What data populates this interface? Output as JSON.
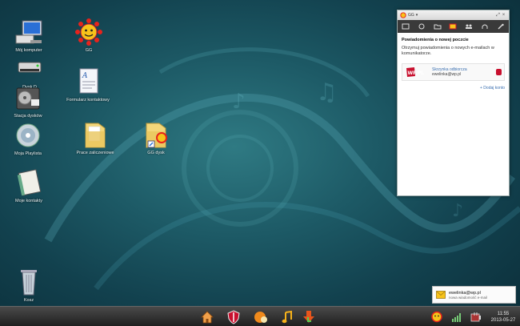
{
  "desktop_icons": [
    {
      "id": "moj-komputer",
      "label": "Mój komputer",
      "icon": "computer-icon"
    },
    {
      "id": "dysk-d",
      "label": "Dysk D",
      "icon": "drive-icon"
    },
    {
      "id": "stacja-dyskow",
      "label": "Stacja dysków",
      "icon": "dvd-drive-icon"
    },
    {
      "id": "moja-playlista",
      "label": "Moja Playlista",
      "icon": "playlist-cd-icon"
    },
    {
      "id": "moje-kontakty",
      "label": "Moje kontakty",
      "icon": "contacts-book-icon"
    },
    {
      "id": "kosz",
      "label": "Kosz",
      "icon": "recycle-bin-icon"
    },
    {
      "id": "gg",
      "label": "GG",
      "icon": "gg-sun-icon"
    },
    {
      "id": "formularz",
      "label": "Formularz kontaktowy",
      "icon": "document-icon"
    },
    {
      "id": "prace",
      "label": "Prace zaliczeniowe",
      "icon": "folder-icon"
    },
    {
      "id": "gg-dysk",
      "label": "GG dysk",
      "icon": "gg-folder-icon"
    }
  ],
  "gg_window": {
    "title": "GG",
    "title_buttons": [
      "⤢",
      "×"
    ],
    "heading": "Powiadomienia o nowej poczcie",
    "description": "Otrzymuj powiadomienia o nowych e-mailach w komunikatorze.",
    "account": {
      "provider_logo": "WP.PL",
      "name": "Skrzynka odbiorcza",
      "email": "ewelinka@wp.pl"
    },
    "add_account": "+ Dodaj konto"
  },
  "toast": {
    "email": "ewelinka@wp.pl",
    "message": "nowa wiadomość e-mail"
  },
  "taskbar": {
    "time": "11:55",
    "date": "2013-05-27"
  },
  "colors": {
    "desktop_bg": "#1d5a66",
    "taskbar": "#2b2b2b",
    "link": "#3a6fb0",
    "wp_red": "#c8102e"
  }
}
